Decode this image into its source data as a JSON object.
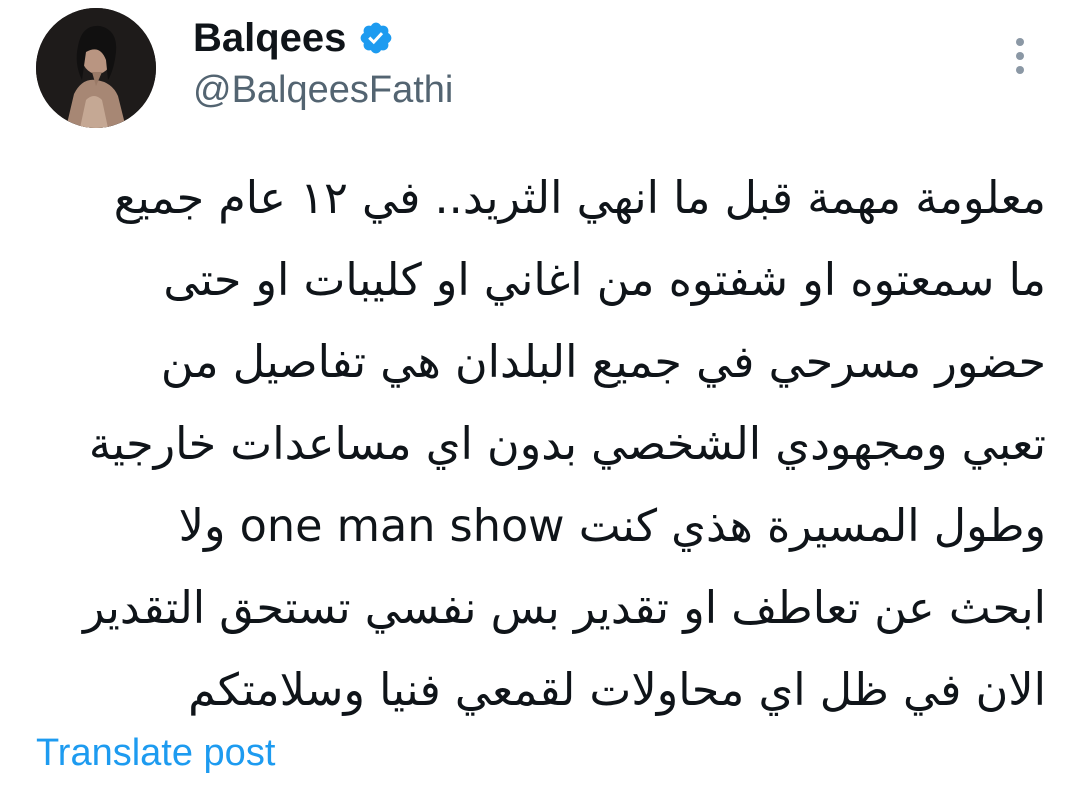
{
  "author": {
    "display_name": "Balqees",
    "handle": "@BalqeesFathi",
    "verified": true,
    "verified_icon": "verified-badge-icon",
    "avatar": "profile-photo"
  },
  "menu": {
    "icon": "more-vertical-icon"
  },
  "tweet": {
    "lines": [
      "معلومة مهمة قبل ما انهي الثريد.. في ١٢ عام جميع",
      "ما سمعتوه او شفتوه من اغاني او كليبات او حتى",
      "حضور مسرحي في جميع البلدان هي تفاصيل من",
      "تعبي ومجهودي الشخصي بدون اي مساعدات خارجية",
      "وطول المسيرة هذي كنت one man show ولا",
      "ابحث عن تعاطف او تقدير بس نفسي تستحق التقدير",
      "الان في ظل اي محاولات لقمعي فنيا وسلامتكم"
    ]
  },
  "actions": {
    "translate_label": "Translate post"
  },
  "colors": {
    "text": "#0f1419",
    "secondary": "#536471",
    "link": "#1d9bf0",
    "verified": "#1d9bf0",
    "background": "#ffffff"
  }
}
